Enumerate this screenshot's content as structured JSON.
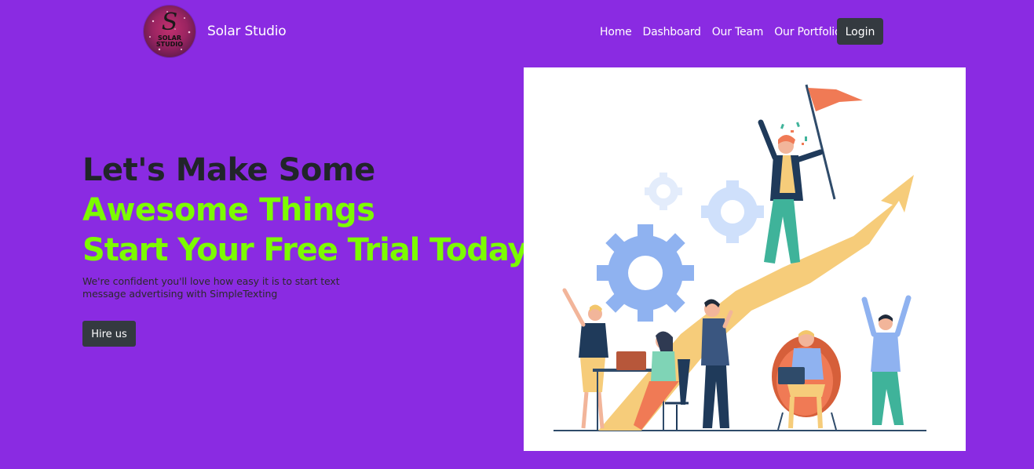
{
  "brand": {
    "logo_text": "SOLAR\nSTUDIO",
    "name": "Solar Studio"
  },
  "nav": {
    "links": [
      "Home",
      "Dashboard",
      "Our Team",
      "Our Portfolio"
    ],
    "login_label": "Login"
  },
  "hero": {
    "line1": "Let's Make Some",
    "line2": "Awesome Things",
    "line3": "Start Your Free Trial Today",
    "subtitle": "We're confident you'll love how easy it is to start text message advertising with SimpleTexting",
    "cta_label": "Hire us"
  },
  "colors": {
    "background": "#8a2be2",
    "accent_green": "#7cfc00",
    "button_dark": "#343a40"
  }
}
